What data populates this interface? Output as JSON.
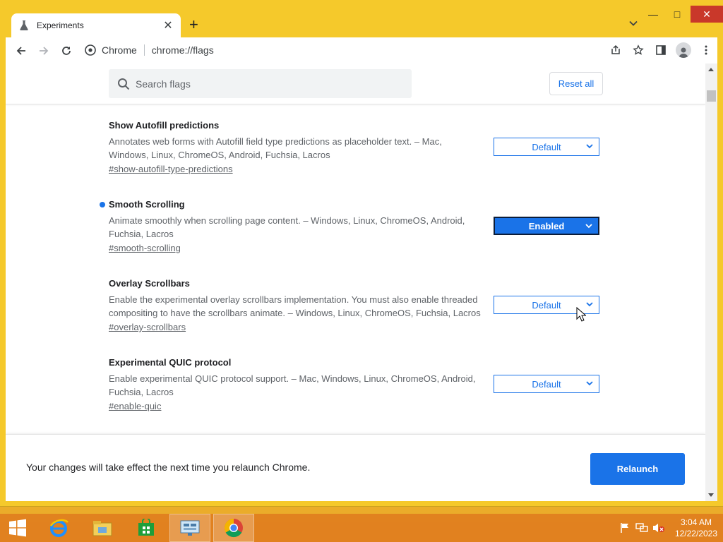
{
  "browser": {
    "tab_title": "Experiments",
    "site_label": "Chrome",
    "url": "chrome://flags"
  },
  "header": {
    "search_placeholder": "Search flags",
    "reset_label": "Reset all"
  },
  "flags": [
    {
      "title": "Show Autofill predictions",
      "description": "Annotates web forms with Autofill field type predictions as placeholder text. – Mac, Windows, Linux, ChromeOS, Android, Fuchsia, Lacros",
      "link": "#show-autofill-type-predictions",
      "value": "Default",
      "modified": false
    },
    {
      "title": "Smooth Scrolling",
      "description": "Animate smoothly when scrolling page content. – Windows, Linux, ChromeOS, Android, Fuchsia, Lacros",
      "link": "#smooth-scrolling",
      "value": "Enabled",
      "modified": true
    },
    {
      "title": "Overlay Scrollbars",
      "description": "Enable the experimental overlay scrollbars implementation. You must also enable threaded compositing to have the scrollbars animate. – Windows, Linux, ChromeOS, Fuchsia, Lacros",
      "link": "#overlay-scrollbars",
      "value": "Default",
      "modified": false
    },
    {
      "title": "Experimental QUIC protocol",
      "description": "Enable experimental QUIC protocol support. – Mac, Windows, Linux, ChromeOS, Android, Fuchsia, Lacros",
      "link": "#enable-quic",
      "value": "Default",
      "modified": false
    }
  ],
  "relaunch": {
    "message": "Your changes will take effect the next time you relaunch Chrome.",
    "button_label": "Relaunch"
  },
  "taskbar": {
    "time": "3:04 AM",
    "date": "12/22/2023"
  },
  "colors": {
    "accent": "#1a73e8",
    "frame": "#f5c92b",
    "taskbar": "#e07e1e"
  },
  "icons": [
    "flask-icon",
    "close-icon",
    "plus-icon",
    "chevron-down-icon",
    "back-icon",
    "forward-icon",
    "reload-icon",
    "chrome-icon",
    "share-icon",
    "star-icon",
    "side-panel-icon",
    "profile-icon",
    "menu-icon",
    "search-icon",
    "windows-start-icon",
    "ie-icon",
    "explorer-icon",
    "store-icon",
    "control-panel-icon",
    "flag-icon",
    "network-icon",
    "volume-muted-icon"
  ]
}
